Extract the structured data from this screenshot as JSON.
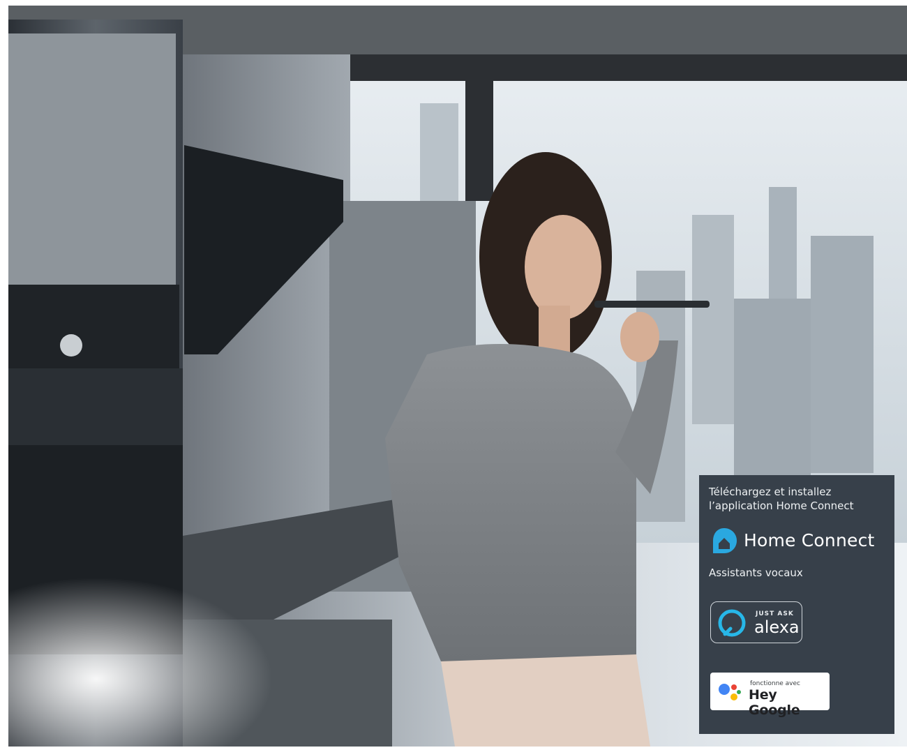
{
  "panel": {
    "download_text_line1": "Téléchargez et installez",
    "download_text_line2": "l’application Home Connect",
    "brand": "Home Connect",
    "voice_assistants": "Assistants vocaux",
    "alexa_badge": {
      "small": "JUST ASK",
      "word": "alexa"
    },
    "google_badge": {
      "small": "fonctionne avec",
      "word": "Hey Google"
    },
    "colors": {
      "panel_bg": "#37404a",
      "brand_blue": "#2aa8e0",
      "alexa_cyan": "#27b7e8"
    }
  },
  "photo": {
    "icon": "kitchen-photo"
  }
}
